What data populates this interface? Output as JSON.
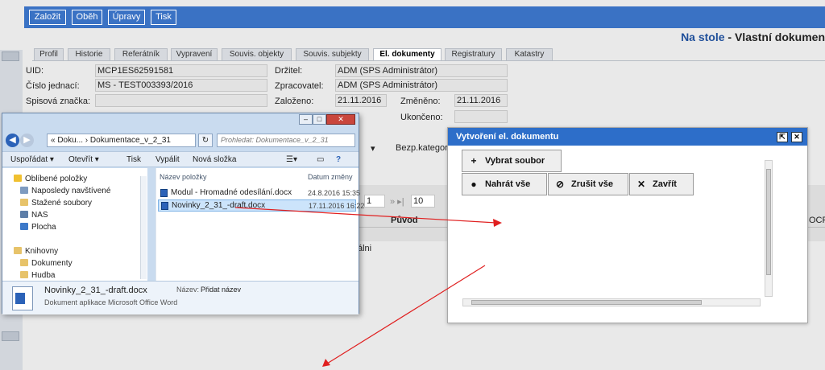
{
  "toolbar": {
    "buttons": [
      "Založit",
      "Oběh",
      "Úpravy",
      "Tisk"
    ]
  },
  "page_title": {
    "accent": "Na stole",
    "rest": " - Vlastní dokumen"
  },
  "tabs": [
    "Profil",
    "Historie",
    "Referátník",
    "Vypravení",
    "Souvis. objekty",
    "Souvis. subjekty",
    "El. dokumenty",
    "Registratury",
    "Katastry"
  ],
  "active_tab": "El. dokumenty",
  "form": {
    "uid_label": "UID:",
    "uid_value": "MCP1ES62591581",
    "cj_label": "Číslo jednací:",
    "cj_value": "MS - TEST003393/2016",
    "sz_label": "Spisová značka:",
    "drzitel_label": "Držitel:",
    "drzitel_value": "ADM (SPS Administrátor)",
    "zprac_label": "Zpracovatel:",
    "zprac_value": "ADM (SPS Administrátor)",
    "zalozeno_label": "Založeno:",
    "zalozeno_value": "21.11.2016",
    "zmeneno_label": "Změněno:",
    "zmeneno_value": "21.11.2016",
    "ukonceno_label": "Ukončeno:",
    "bezp_label": "Bezp.kategor"
  },
  "grid": {
    "page_value": "1",
    "page_size": "10",
    "col_puvod": "Původ",
    "col_ocr": "OCR",
    "row_text": "álni"
  },
  "explorer": {
    "address": "« Doku... › Dokumentace_v_2_31",
    "search_placeholder": "Prohledat: Dokumentace_v_2_31",
    "toolbar": [
      "Uspořádat ▾",
      "Otevřít ▾",
      "Tisk",
      "Vypálit",
      "Nová složka"
    ],
    "nav": [
      "Oblíbené položky",
      "Naposledy navštívené",
      "Stažené soubory",
      "NAS",
      "Plocha",
      "Knihovny",
      "Dokumenty",
      "Hudba"
    ],
    "col_name": "Název položky",
    "col_date": "Datum změny",
    "files": [
      {
        "name": "Modul - Hromadné odesílání.docx",
        "date": "24.8.2016 15:35"
      },
      {
        "name": "Novinky_2_31_-draft.docx",
        "date": "17.11.2016 16:22"
      }
    ],
    "details": {
      "filename": "Novinky_2_31_-draft.docx",
      "type": "Dokument aplikace Microsoft Office Word",
      "name_label": "Název:",
      "name_value": "Přidat název"
    }
  },
  "dialog": {
    "title": "Vytvoření el. dokumentu",
    "select_file": "Vybrat soubor",
    "upload_all": "Nahrát vše",
    "cancel_all": "Zrušit vše",
    "close": "Zavřít"
  },
  "colors": {
    "accent": "#3a72c4",
    "dialog_header": "#2d6ec9",
    "arrow": "#e02020"
  }
}
